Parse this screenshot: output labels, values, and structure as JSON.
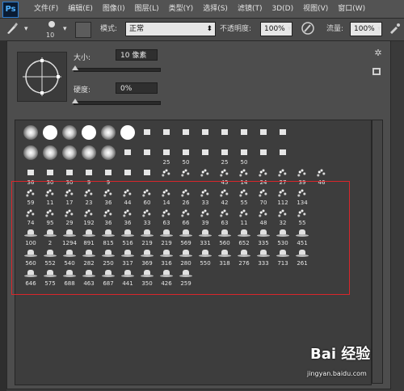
{
  "app": {
    "logo": "Ps"
  },
  "menu": [
    "文件(F)",
    "编辑(E)",
    "图像(I)",
    "图层(L)",
    "类型(Y)",
    "选择(S)",
    "滤镜(T)",
    "3D(D)",
    "视图(V)",
    "窗口(W)"
  ],
  "toolbar": {
    "brush_size": "10",
    "mode_label": "模式:",
    "mode_value": "正常",
    "opacity_label": "不透明度:",
    "opacity_value": "100%",
    "flow_label": "流量:",
    "flow_value": "100%"
  },
  "brush_panel": {
    "size_label": "大小:",
    "size_value": "10 像素",
    "hardness_label": "硬度:",
    "hardness_value": "0%"
  },
  "brushes": [
    [
      "",
      "",
      "",
      "",
      "",
      "",
      "",
      "",
      "",
      "",
      "",
      "",
      "",
      ""
    ],
    [
      "",
      "",
      "",
      "",
      "",
      "",
      "",
      "25",
      "50",
      "",
      "25",
      "50",
      "",
      ""
    ],
    [
      "36",
      "30",
      "30",
      "9",
      "9",
      "",
      "",
      "",
      "",
      "",
      "45",
      "14",
      "24",
      "27",
      "39",
      "46"
    ],
    [
      "59",
      "11",
      "17",
      "23",
      "36",
      "44",
      "60",
      "14",
      "26",
      "33",
      "42",
      "55",
      "70",
      "112",
      "134"
    ],
    [
      "74",
      "95",
      "29",
      "192",
      "36",
      "36",
      "33",
      "63",
      "66",
      "39",
      "63",
      "11",
      "48",
      "32",
      "55"
    ],
    [
      "100",
      "2",
      "1294",
      "891",
      "815",
      "516",
      "219",
      "219",
      "569",
      "331",
      "560",
      "652",
      "335",
      "530",
      "451"
    ],
    [
      "560",
      "552",
      "540",
      "282",
      "250",
      "317",
      "369",
      "316",
      "280",
      "550",
      "318",
      "276",
      "333",
      "713",
      "261"
    ],
    [
      "646",
      "575",
      "688",
      "463",
      "687",
      "441",
      "350",
      "426",
      "259"
    ]
  ],
  "watermark": {
    "logo": "Bai 经验",
    "url": "jingyan.baidu.com"
  },
  "colors": {
    "highlight": "#d9262b",
    "panel": "#4d4d4d"
  }
}
